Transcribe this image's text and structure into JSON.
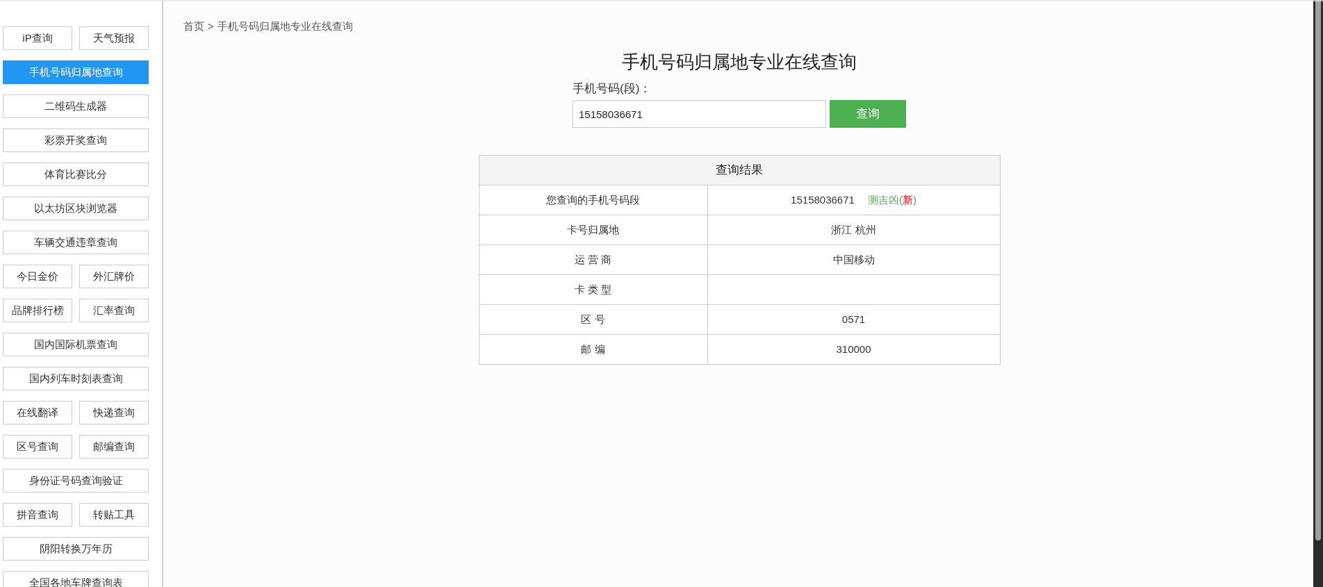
{
  "sidebar": {
    "rows": [
      {
        "items": [
          {
            "label": "iP查询",
            "selected": false
          },
          {
            "label": "天气预报",
            "selected": false
          }
        ]
      },
      {
        "items": [
          {
            "label": "手机号码归属地查询",
            "selected": true
          }
        ]
      },
      {
        "items": [
          {
            "label": "二维码生成器",
            "selected": false
          }
        ]
      },
      {
        "items": [
          {
            "label": "彩票开奖查询",
            "selected": false
          }
        ]
      },
      {
        "items": [
          {
            "label": "体育比赛比分",
            "selected": false
          }
        ]
      },
      {
        "items": [
          {
            "label": "以太坊区块浏览器",
            "selected": false
          }
        ]
      },
      {
        "items": [
          {
            "label": "车辆交通违章查询",
            "selected": false
          }
        ]
      },
      {
        "items": [
          {
            "label": "今日金价",
            "selected": false
          },
          {
            "label": "外汇牌价",
            "selected": false
          }
        ]
      },
      {
        "items": [
          {
            "label": "品牌排行榜",
            "selected": false
          },
          {
            "label": "汇率查询",
            "selected": false
          }
        ]
      },
      {
        "items": [
          {
            "label": "国内国际机票查询",
            "selected": false
          }
        ]
      },
      {
        "items": [
          {
            "label": "国内列车时刻表查询",
            "selected": false
          }
        ]
      },
      {
        "items": [
          {
            "label": "在线翻译",
            "selected": false
          },
          {
            "label": "快递查询",
            "selected": false
          }
        ]
      },
      {
        "items": [
          {
            "label": "区号查询",
            "selected": false
          },
          {
            "label": "邮编查询",
            "selected": false
          }
        ]
      },
      {
        "items": [
          {
            "label": "身份证号码查询验证",
            "selected": false
          }
        ]
      },
      {
        "items": [
          {
            "label": "拼音查询",
            "selected": false
          },
          {
            "label": "转贴工具",
            "selected": false
          }
        ]
      },
      {
        "items": [
          {
            "label": "阴阳转换万年历",
            "selected": false
          }
        ]
      },
      {
        "items": [
          {
            "label": "全国各地车牌查询表",
            "selected": false
          }
        ]
      }
    ]
  },
  "breadcrumb": {
    "home": "首页",
    "separator": ">",
    "current": "手机号码归属地专业在线查询"
  },
  "title": "手机号码归属地专业在线查询",
  "form": {
    "label": "手机号码(段)：",
    "value": "15158036671",
    "button": "查询"
  },
  "result": {
    "heading": "查询结果",
    "rows": [
      {
        "label": "您查询的手机号码段",
        "value": "15158036671",
        "link": {
          "before": "测吉凶(",
          "mark": "新",
          "after": ")"
        }
      },
      {
        "label": "卡号归属地",
        "value": "浙江 杭州"
      },
      {
        "label": "运 营 商",
        "value": "中国移动"
      },
      {
        "label": "卡 类 型"
      },
      {
        "label": "区 号",
        "value": "0571"
      },
      {
        "label": "邮 编",
        "value": "310000"
      }
    ]
  }
}
